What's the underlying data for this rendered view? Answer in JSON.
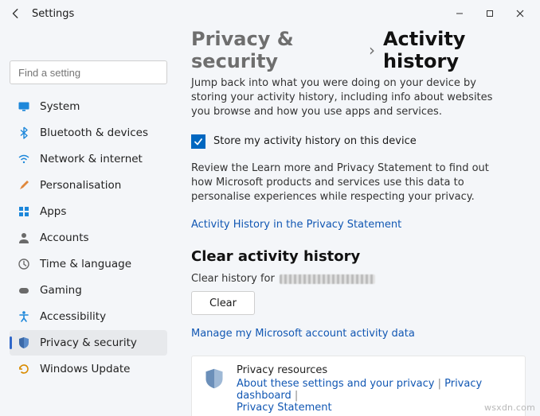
{
  "window": {
    "title": "Settings",
    "controls": {
      "minimize": "minimize",
      "maximize": "maximize",
      "close": "close"
    }
  },
  "sidebar": {
    "searchPlaceholder": "Find a setting",
    "items": [
      {
        "label": "System"
      },
      {
        "label": "Bluetooth & devices"
      },
      {
        "label": "Network & internet"
      },
      {
        "label": "Personalisation"
      },
      {
        "label": "Apps"
      },
      {
        "label": "Accounts"
      },
      {
        "label": "Time & language"
      },
      {
        "label": "Gaming"
      },
      {
        "label": "Accessibility"
      },
      {
        "label": "Privacy & security"
      },
      {
        "label": "Windows Update"
      }
    ]
  },
  "main": {
    "breadcrumbParent": "Privacy & security",
    "breadcrumbCurrent": "Activity history",
    "intro": "Jump back into what you were doing on your device by storing your activity history, including info about websites you browse and how you use apps and services.",
    "checkboxLabel": "Store my activity history on this device",
    "reviewText": "Review the Learn more and Privacy Statement to find out how Microsoft products and services use this data to personalise experiences while respecting your privacy.",
    "privacyStatementLink": "Activity History in the Privacy Statement",
    "clearSection": {
      "title": "Clear activity history",
      "labelPrefix": "Clear history for",
      "buttonLabel": "Clear",
      "manageLink": "Manage my Microsoft account activity data"
    },
    "resourcesCard": {
      "title": "Privacy resources",
      "links": [
        "About these settings and your privacy",
        "Privacy dashboard",
        "Privacy Statement"
      ]
    }
  },
  "watermark": "wsxdn.com"
}
